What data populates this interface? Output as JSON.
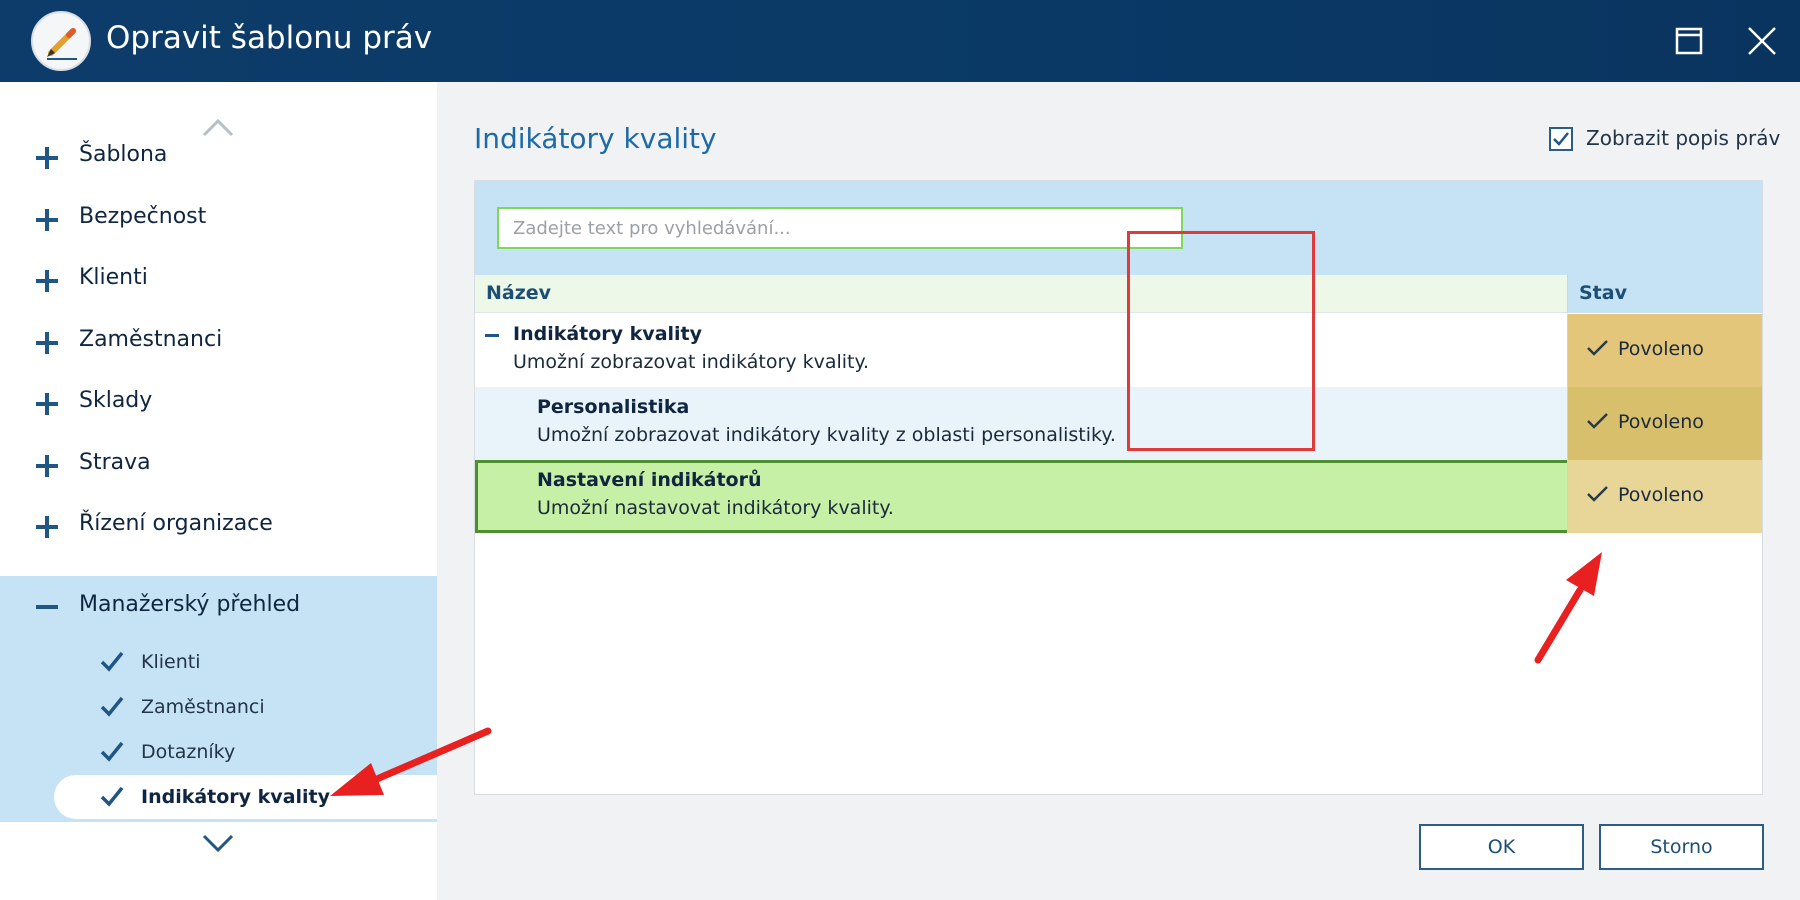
{
  "window": {
    "title": "Opravit šablonu práv",
    "icons": {
      "app": "pencil-logo-icon",
      "maximize": "maximize-icon",
      "close": "close-icon"
    }
  },
  "sidebar": {
    "items": [
      {
        "label": "Šablona",
        "icon": "plus-icon"
      },
      {
        "label": "Bezpečnost",
        "icon": "plus-icon"
      },
      {
        "label": "Klienti",
        "icon": "plus-icon"
      },
      {
        "label": "Zaměstnanci",
        "icon": "plus-icon"
      },
      {
        "label": "Sklady",
        "icon": "plus-icon"
      },
      {
        "label": "Strava",
        "icon": "plus-icon"
      },
      {
        "label": "Řízení organizace",
        "icon": "plus-icon"
      },
      {
        "label": "Manažerský přehled",
        "icon": "minus-icon"
      }
    ],
    "subitems": [
      {
        "label": "Klienti",
        "icon": "check-icon"
      },
      {
        "label": "Zaměstnanci",
        "icon": "check-icon"
      },
      {
        "label": "Dotazníky",
        "icon": "check-icon"
      },
      {
        "label": "Indikátory kvality",
        "icon": "check-icon",
        "active": true
      }
    ]
  },
  "content": {
    "title": "Indikátory kvality",
    "show_description_label": "Zobrazit popis práv",
    "show_description_checked": true,
    "search": {
      "placeholder": "Zadejte text pro vyhledávání...",
      "value": ""
    },
    "table": {
      "headers": {
        "name": "Název",
        "state": "Stav"
      },
      "rows": [
        {
          "title": "Indikátory kvality",
          "description": "Umožní zobrazovat indikátory kvality.",
          "state": "Povoleno"
        },
        {
          "title": "Personalistika",
          "description": "Umožní zobrazovat indikátory kvality z oblasti personalistiky.",
          "state": "Povoleno"
        },
        {
          "title": "Nastavení indikátorů",
          "description": "Umožní nastavovat indikátory kvality.",
          "state": "Povoleno"
        }
      ]
    }
  },
  "buttons": {
    "ok": "OK",
    "cancel": "Storno"
  },
  "colors": {
    "titlebar": "#0e3c6a",
    "accent": "#1d6aa6",
    "selection": "#c6f0a5",
    "state_cell": "#e3c67a",
    "annotation": "#e03a3a"
  }
}
